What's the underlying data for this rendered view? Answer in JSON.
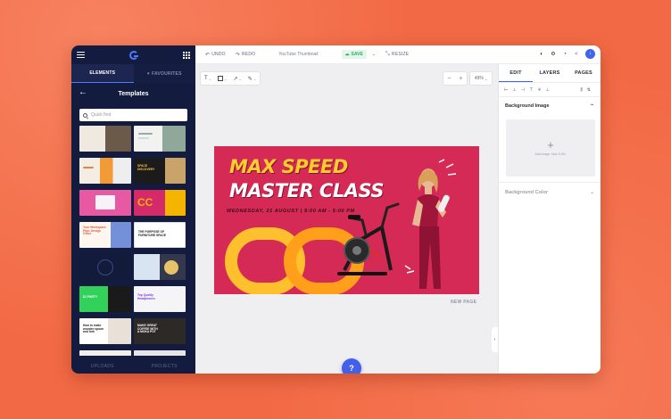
{
  "left_panel": {
    "tabs": [
      "ELEMENTS",
      "FAVOURITES"
    ],
    "title": "Templates",
    "search_placeholder": "Quick find",
    "bottom": [
      "UPLOADS",
      "PROJECTS"
    ],
    "thumb_texts": {
      "t4": "SPACE\nDISCOVERY",
      "t6": "CC",
      "t7": "Your Workspace\nPlan: Design\nOffice",
      "t8": "THE PURPOSE OF\nFURNITURE SPACE",
      "t11": "DJ PARTY",
      "t12": "Top Quality\nHeadphones",
      "t13": "How to make\nwooden spoon\nand fork",
      "t14": "MAKE GREAT\nCOFFEE WITH\nA MOKA POT"
    }
  },
  "topbar": {
    "undo": "UNDO",
    "redo": "REDO",
    "doc_title": "YouTube Thumbnail",
    "save": "SAVE",
    "resize": "RESIZE"
  },
  "canvas": {
    "zoom": "49%",
    "new_page": "NEW PAGE",
    "help": "?",
    "design": {
      "line1": "MAX SPEED",
      "line2": "MASTER CLASS",
      "subline": "WEDNESDAY, 21 AUGUST | 9:00 AM - 5:00 PM"
    }
  },
  "right_panel": {
    "tabs": [
      "EDIT",
      "LAYERS",
      "PAGES"
    ],
    "background_image": "Background Image",
    "upload_text": "Add image. Max 5 Mb.",
    "background_color": "Background Color"
  },
  "colors": {
    "accent": "#3f64f0",
    "sidebar": "#131c3e",
    "design_bg": "#d42a55",
    "headline_yellow": "#ffcc2e",
    "save_green": "#2cae5e"
  },
  "icons": [
    "hamburger-icon",
    "logo-icon",
    "apps-grid-icon",
    "heart-icon",
    "back-arrow-icon",
    "search-icon",
    "undo-icon",
    "redo-icon",
    "cloud-icon",
    "chevron-down-icon",
    "resize-icon",
    "dark-mode-icon",
    "settings-icon",
    "history-icon",
    "share-icon",
    "download-icon",
    "text-tool-icon",
    "shape-tool-icon",
    "line-tool-icon",
    "draw-tool-icon",
    "plus-icon",
    "minus-icon",
    "chevron-left-icon",
    "chevron-right-icon",
    "chevron-up-icon"
  ]
}
